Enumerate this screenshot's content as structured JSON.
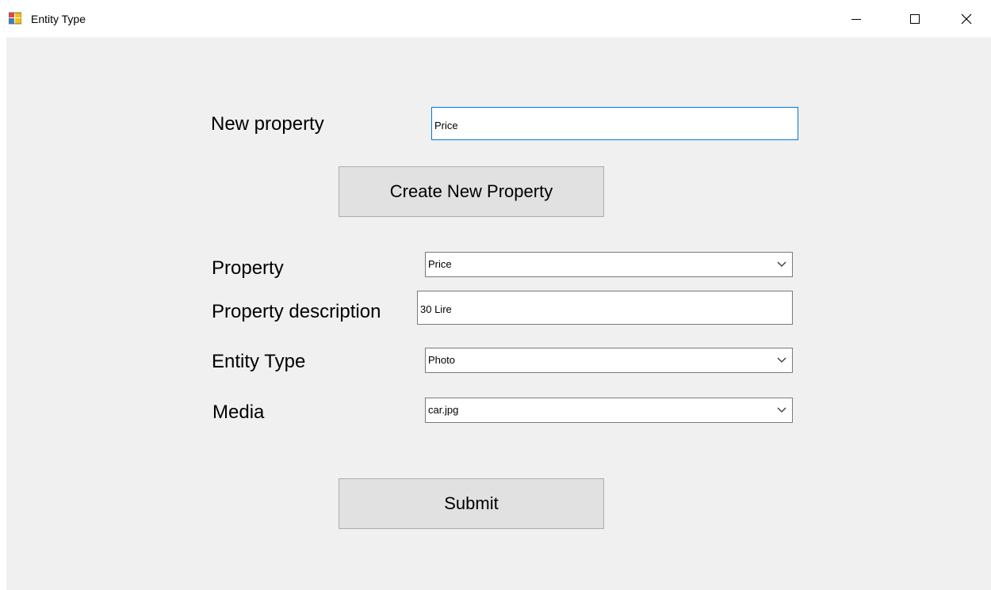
{
  "window": {
    "title": "Entity Type"
  },
  "form": {
    "new_property_label": "New property",
    "new_property_value": "Price",
    "create_button_label": "Create New Property",
    "property_label": "Property",
    "property_selected": "Price",
    "property_description_label": "Property description",
    "property_description_value": "30 Lire",
    "entity_type_label": "Entity Type",
    "entity_type_selected": "Photo",
    "media_label": "Media",
    "media_selected": "car.jpg",
    "submit_button_label": "Submit"
  },
  "colors": {
    "client_background": "#f0f0f0",
    "button_background": "#e1e1e1",
    "focus_border": "#0078d7"
  }
}
